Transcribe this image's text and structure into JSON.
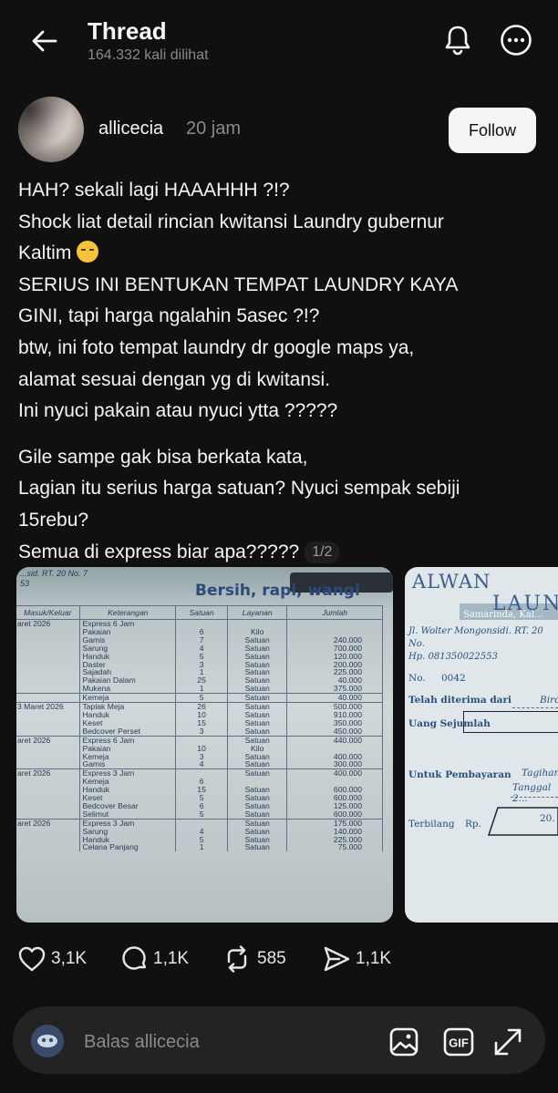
{
  "header": {
    "title": "Thread",
    "views": "164.332 kali dilihat",
    "back_icon": "arrow-left-icon",
    "notification_icon": "bell-icon",
    "more_icon": "more-horizontal-icon"
  },
  "author": {
    "username": "allicecia",
    "time": "20 jam",
    "follow_label": "Follow"
  },
  "post": {
    "paragraph1": [
      "HAH? sekali lagi HAAAHHH ?!?",
      "Shock liat detail rincian kwitansi Laundry gubernur",
      "Kaltim",
      "SERIUS INI BENTUKAN TEMPAT LAUNDRY KAYA",
      "GINI, tapi harga ngalahin 5asec ?!?",
      "btw, ini foto tempat laundry dr google maps ya,",
      "alamat sesuai dengan yg di kwitansi.",
      "Ini nyuci pakain atau nyuci ytta ?????"
    ],
    "paragraph2": [
      "Gile sampe gak bisa berkata kata,",
      "Lagian itu serius harga satuan? Nyuci sempak sebiji",
      "15rebu?",
      "Semua di express biar apa?????"
    ],
    "emoji": "face-steam-from-nose-emoji",
    "pager": "1/2"
  },
  "media": {
    "image1": {
      "title": "Bersih, rapi, wangi",
      "corner_text": "...sid. RT. 20 No. 7",
      "corner_text2": "53",
      "headers": [
        "Masuk/Keluar",
        "Keterangan",
        "Satuan",
        "Layanan",
        "Jumlah"
      ],
      "rows": [
        [
          "aret 2026",
          "Express 6 Jam",
          "",
          "",
          ""
        ],
        [
          "",
          "Pakaian",
          "6",
          "Kilo",
          ""
        ],
        [
          "",
          "Gamis",
          "7",
          "Satuan",
          "240.000"
        ],
        [
          "",
          "Sarung",
          "4",
          "Satuan",
          "700.000"
        ],
        [
          "",
          "Handuk",
          "5",
          "Satuan",
          "120.000"
        ],
        [
          "",
          "Daster",
          "3",
          "Satuan",
          "200.000"
        ],
        [
          "",
          "Sajadah",
          "1",
          "Satuan",
          "225.000"
        ],
        [
          "",
          "Pakaian Dalam",
          "25",
          "Satuan",
          "40.000"
        ],
        [
          "",
          "Mukena",
          "1",
          "Satuan",
          "375.000"
        ],
        [
          "",
          "Kemeja",
          "5",
          "Satuan",
          "40.000"
        ],
        [
          "3 Maret 2026",
          "Taplak Meja",
          "26",
          "Satuan",
          "500.000"
        ],
        [
          "",
          "Handuk",
          "10",
          "Satuan",
          "910.000"
        ],
        [
          "",
          "Keset",
          "15",
          "Satuan",
          "350.000"
        ],
        [
          "",
          "Bedcover Perset",
          "3",
          "Satuan",
          "450.000"
        ],
        [
          "aret 2026",
          "Express 6 Jam",
          "",
          "Satuan",
          "440.000"
        ],
        [
          "",
          "Pakaian",
          "10",
          "Kilo",
          ""
        ],
        [
          "",
          "Kemeja",
          "3",
          "Satuan",
          "400.000"
        ],
        [
          "",
          "Gamis",
          "4",
          "Satuan",
          "300.000"
        ],
        [
          "aret 2026",
          "Express 3 Jam",
          "",
          "Satuan",
          "400.000"
        ],
        [
          "",
          "Kemeja",
          "6",
          "",
          ""
        ],
        [
          "",
          "Handuk",
          "15",
          "Satuan",
          "600.000"
        ],
        [
          "",
          "Keset",
          "5",
          "Satuan",
          "600.000"
        ],
        [
          "",
          "Bedcover Besar",
          "6",
          "Satuan",
          "125.000"
        ],
        [
          "",
          "Selimut",
          "5",
          "Satuan",
          "600.000"
        ],
        [
          "aret 2026",
          "Express 3 Jam",
          "",
          "Satuan",
          "175.000"
        ],
        [
          "",
          "Sarung",
          "4",
          "Satuan",
          "140.000"
        ],
        [
          "",
          "Handuk",
          "5",
          "Satuan",
          "225.000"
        ],
        [
          "",
          "Celana Panjang",
          "1",
          "Satuan",
          "75.000"
        ]
      ],
      "separator_rows": [
        9,
        10,
        14,
        18,
        24
      ]
    },
    "image2": {
      "title": "ALWAN",
      "banner": "Samarinda, Kal...",
      "banner_big": "LAUNDR",
      "address1": "Jl. Wolter Mongonsidi. RT. 20 No.",
      "address2": "Hp. 081350022553",
      "no_label": "No.",
      "no_value": "0042",
      "received_label": "Telah diterima dari",
      "received_value": "Biro",
      "amount_label": "Uang Sejumlah",
      "payment_label": "Untuk Pembayaran",
      "payment_value1": "Tagihan",
      "payment_value2": "Tanggal 2...",
      "spelled_label": "Terbilang",
      "spelled_currency": "Rp.",
      "spelled_value": "20."
    }
  },
  "actions": {
    "likes": "3,1K",
    "replies": "1,1K",
    "reposts": "585",
    "shares": "1,1K"
  },
  "reply": {
    "placeholder": "Balas allicecia"
  },
  "colors": {
    "background": "#101010",
    "text": "#f3f5f7",
    "muted": "#8a8a8a",
    "reply_bar": "#232323",
    "follow_bg": "#f3f5f7"
  }
}
